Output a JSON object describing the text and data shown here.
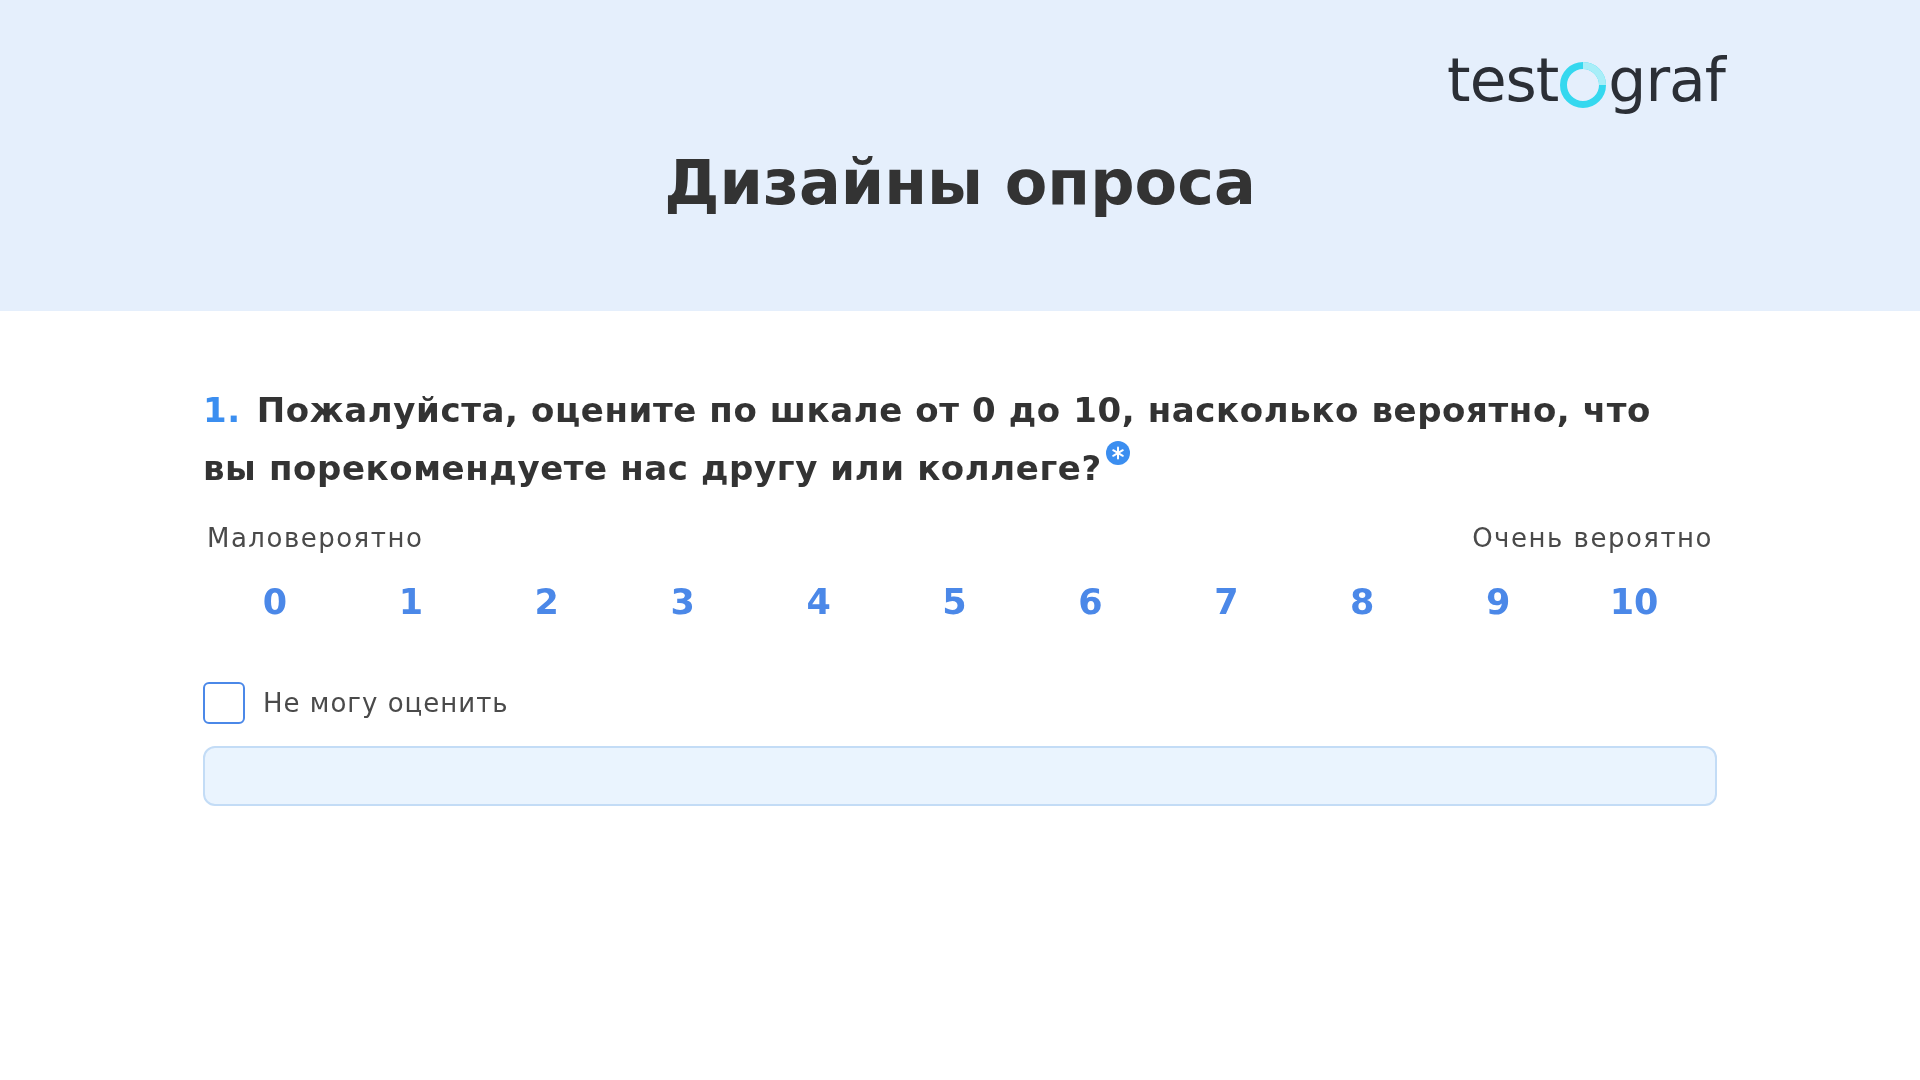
{
  "header": {
    "logo": {
      "text_before_ring": "test",
      "text_after_ring": "graf"
    },
    "title": "Дизайны опроса"
  },
  "question": {
    "number": "1.",
    "text": "Пожалуйста, оцените по шкале от 0 до 10, насколько вероятно, что вы порекомендуете нас другу или коллеге?",
    "required": true,
    "scale": {
      "left_label": "Маловероятно",
      "right_label": "Очень вероятно",
      "options": [
        {
          "label": "0",
          "selected": false
        },
        {
          "label": "1",
          "selected": false
        },
        {
          "label": "2",
          "selected": false
        },
        {
          "label": "3",
          "selected": false
        },
        {
          "label": "4",
          "selected": false
        },
        {
          "label": "5",
          "selected": false
        },
        {
          "label": "6",
          "selected": false
        },
        {
          "label": "7",
          "selected": false
        },
        {
          "label": "8",
          "selected": false
        },
        {
          "label": "9",
          "selected": false
        },
        {
          "label": "10",
          "selected": false
        }
      ]
    },
    "cannot_rate": {
      "label": "Не могу оценить",
      "checked": false
    },
    "comment_field": {
      "kind": "text"
    }
  }
}
